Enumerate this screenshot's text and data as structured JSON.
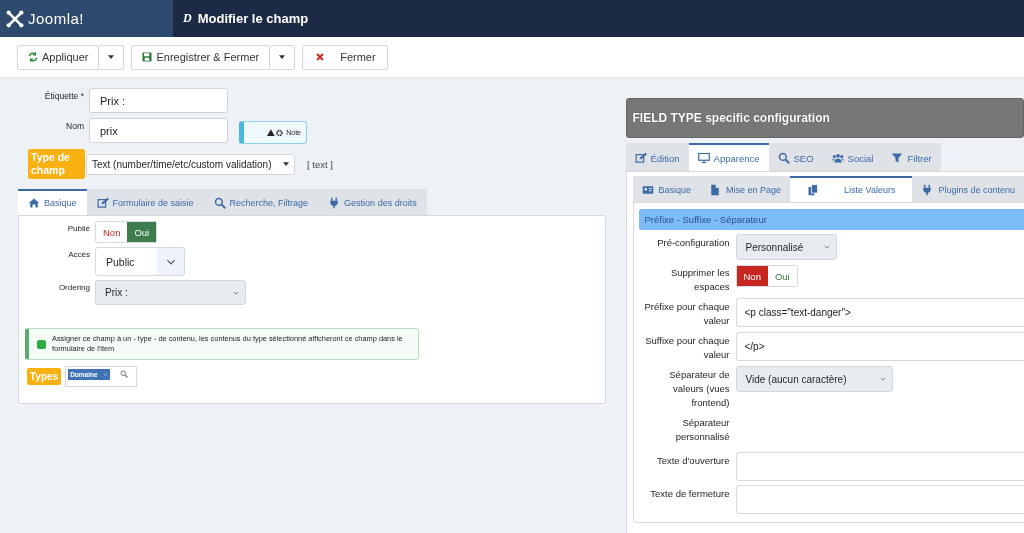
{
  "header": {
    "logo_text": "Joomla!",
    "title_icon": "D",
    "title": "Modifier le champ"
  },
  "toolbar": [
    {
      "label": "Appliquer",
      "kind": "refresh",
      "dropdown": true
    },
    {
      "label": "Enregistrer & Fermer",
      "kind": "save",
      "dropdown": true
    },
    {
      "label": "Fermer",
      "kind": "close",
      "dropdown": false
    }
  ],
  "fields": {
    "label_field": {
      "label": "Étiquette *",
      "value": "Prix :"
    },
    "name_field": {
      "label": "Nom",
      "value": "prix"
    },
    "note": {
      "label": "Note"
    },
    "type_field": {
      "label": "Type de champ",
      "value": "Text (number/time/etc/custom validation)",
      "code": "[ text ]"
    }
  },
  "tabs": [
    {
      "label": "Basique",
      "kind": "home",
      "selected": true
    },
    {
      "label": "Formulaire de saisie",
      "kind": "edit",
      "selected": false
    },
    {
      "label": "Recherche, Filtrage",
      "kind": "search",
      "selected": false
    },
    {
      "label": "Gestion des droits",
      "kind": "plug",
      "selected": false
    }
  ],
  "basic_rows": [
    {
      "kind": "toggle",
      "label": "Publié",
      "options": [
        {
          "label": "Non",
          "kind": "no",
          "selected": false
        },
        {
          "label": "Oui",
          "kind": "yes",
          "selected": true
        }
      ]
    },
    {
      "kind": "bigselect",
      "label": "Accès",
      "value": "Public"
    },
    {
      "kind": "select",
      "label": "Ordering",
      "value": "Prix :"
    }
  ],
  "assign": {
    "checked": true,
    "text": "Assigner ce champ à un - type - de contenu, les contenus du type sélectionné afficheront ce champ dans le formulaire de l'item"
  },
  "types": {
    "label": "Types",
    "tags": [
      {
        "label": "Domaine"
      }
    ]
  },
  "config": {
    "title": "FIELD TYPE specific configuration",
    "tabs": [
      {
        "label": "Édition",
        "kind": "edit",
        "selected": false
      },
      {
        "label": "Apparence",
        "kind": "monitor",
        "selected": true
      },
      {
        "label": "SEO",
        "kind": "search",
        "selected": false
      },
      {
        "label": "Social",
        "kind": "users",
        "selected": false
      },
      {
        "label": "Filtrer",
        "kind": "filter",
        "selected": false
      }
    ],
    "subtabs": [
      {
        "label": "Basique",
        "kind": "card",
        "selected": false
      },
      {
        "label": "Mise en Page",
        "kind": "file",
        "selected": false
      },
      {
        "label": "Liste Valeurs",
        "kind": "copy",
        "selected": true
      },
      {
        "label": "Plugins de contenu",
        "kind": "plug",
        "selected": false
      }
    ],
    "section": "Préfixe - Suffixe - Séparateur",
    "rows": [
      {
        "kind": "select",
        "label": "Pré-configuration",
        "value": "Personnalisé"
      },
      {
        "kind": "toggle",
        "label": "Supprimer les espaces",
        "options": [
          {
            "label": "Non",
            "kind": "no",
            "selected": true
          },
          {
            "label": "Oui",
            "kind": "yes",
            "selected": false
          }
        ]
      },
      {
        "kind": "input",
        "label": "Préfixe pour chaque valeur",
        "value": "<p class=\"text-danger\">"
      },
      {
        "kind": "input",
        "label": "Suffixe pour chaque valeur",
        "value": "</p>"
      },
      {
        "kind": "wideselect",
        "label": "Séparateur de valeurs (vues frontend)",
        "value": "Vide (aucun caractère)"
      },
      {
        "kind": "none",
        "label": "Séparateur personnalisé"
      },
      {
        "kind": "input",
        "label": "Texte d'ouverture"
      },
      {
        "kind": "input",
        "label": "Texte de fermeture"
      }
    ]
  }
}
